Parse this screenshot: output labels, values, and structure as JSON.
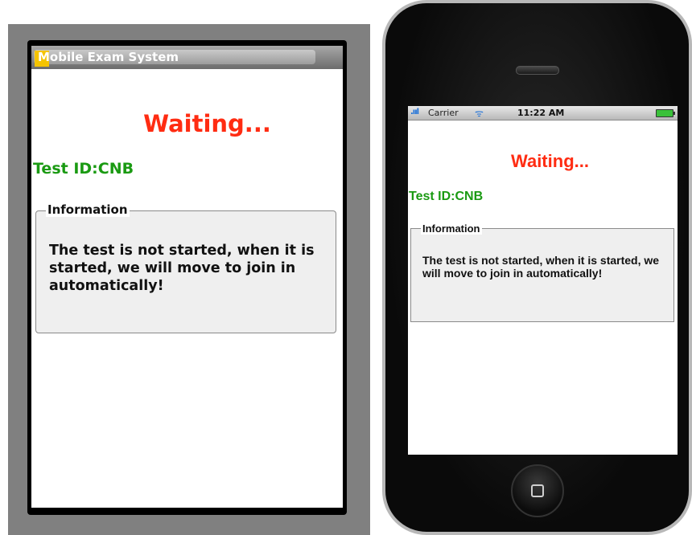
{
  "android": {
    "app_title": "Mobile Exam System",
    "status_text": "Waiting...",
    "test_id": "Test ID:CNB",
    "info_legend": "Information",
    "info_text": "The test is not started, when it is started, we will move to join in automatically!"
  },
  "iphone": {
    "status_bar": {
      "signal": ".ııl",
      "carrier": "Carrier",
      "wifi": "ᯤ",
      "time": "11:22 AM"
    },
    "status_text": "Waiting...",
    "test_id": "Test ID:CNB",
    "info_legend": "Information",
    "info_text": "The test is not started, when it is started, we will move to join in automatically!"
  },
  "colors": {
    "waiting": "#ff2c12",
    "test_id": "#1a9a12",
    "android_bg": "#808080"
  }
}
